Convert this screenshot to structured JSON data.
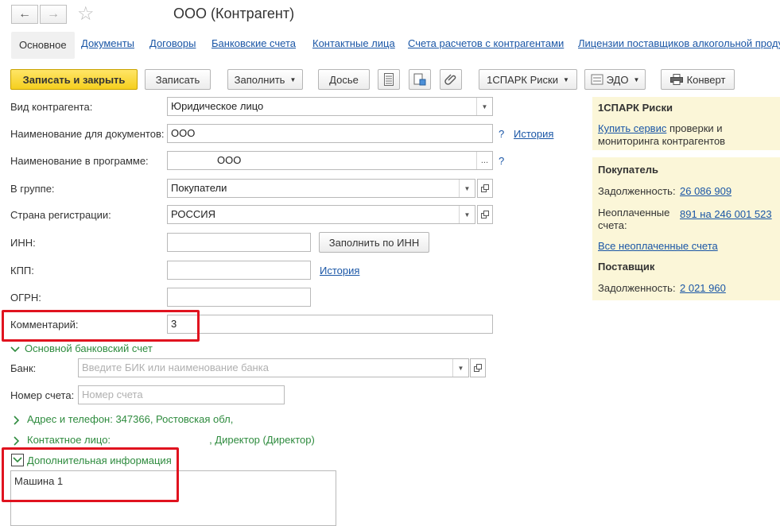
{
  "window": {
    "title": "ООО (Контрагент)"
  },
  "tabs": [
    {
      "label": "Основное",
      "active": true
    },
    {
      "label": "Документы"
    },
    {
      "label": "Договоры"
    },
    {
      "label": "Банковские счета"
    },
    {
      "label": "Контактные лица"
    },
    {
      "label": "Счета расчетов с контрагентами"
    },
    {
      "label": "Лицензии поставщиков алкогольной проду"
    }
  ],
  "toolbar": {
    "save_close": "Записать и закрыть",
    "save": "Записать",
    "fill": "Заполнить",
    "dossier": "Досье",
    "spark": "1СПАРК Риски",
    "edo": "ЭДО",
    "envelope": "Конверт"
  },
  "form": {
    "kind_label": "Вид контрагента:",
    "kind_value": "Юридическое лицо",
    "docname_label": "Наименование для документов:",
    "docname_value": "ООО",
    "history": "История",
    "progname_label": "Наименование в программе:",
    "progname_value": "ООО",
    "group_label": "В группе:",
    "group_value": "Покупатели",
    "country_label": "Страна регистрации:",
    "country_value": "РОССИЯ",
    "inn_label": "ИНН:",
    "inn_value": "",
    "fill_by_inn": "Заполнить по ИНН",
    "kpp_label": "КПП:",
    "kpp_value": "",
    "kpp_history": "История",
    "ogrn_label": "ОГРН:",
    "ogrn_value": "",
    "comment_label": "Комментарий:",
    "comment_value": "3",
    "question": "?"
  },
  "bank_group": {
    "title": "Основной банковский счет",
    "bank_label": "Банк:",
    "bank_placeholder": "Введите БИК или наименование банка",
    "account_label": "Номер счета:",
    "account_placeholder": "Номер счета"
  },
  "address_group": {
    "title": "Адрес и телефон: 347366, Ростовская обл,"
  },
  "contact_group": {
    "title": "Контактное лицо:",
    "suffix": ", Директор (Директор)"
  },
  "extra_group": {
    "title": "Дополнительная информация",
    "text": "Машина 1"
  },
  "side_panel": {
    "spark_title": "1СПАРК Риски",
    "spark_link": "Купить сервис",
    "spark_text1": "проверки и",
    "spark_text2": "мониторинга контрагентов",
    "buyer_title": "Покупатель",
    "debt_label": "Задолженность:",
    "buyer_debt": "26 086 909",
    "unpaid_label1": "Неоплаченные",
    "unpaid_label2": "счета:",
    "unpaid_value": "891 на 246 001 523",
    "all_unpaid": "Все неоплаченные счета",
    "supplier_title": "Поставщик",
    "supplier_debt_label": "Задолженность:",
    "supplier_debt": "2 021 960"
  },
  "colors": {
    "link": "#1a56a6",
    "group_title": "#2e8b3e",
    "primary_button": "#f5cf1e",
    "highlight_box": "#e0131f",
    "side_panel": "#fbf6d8"
  }
}
